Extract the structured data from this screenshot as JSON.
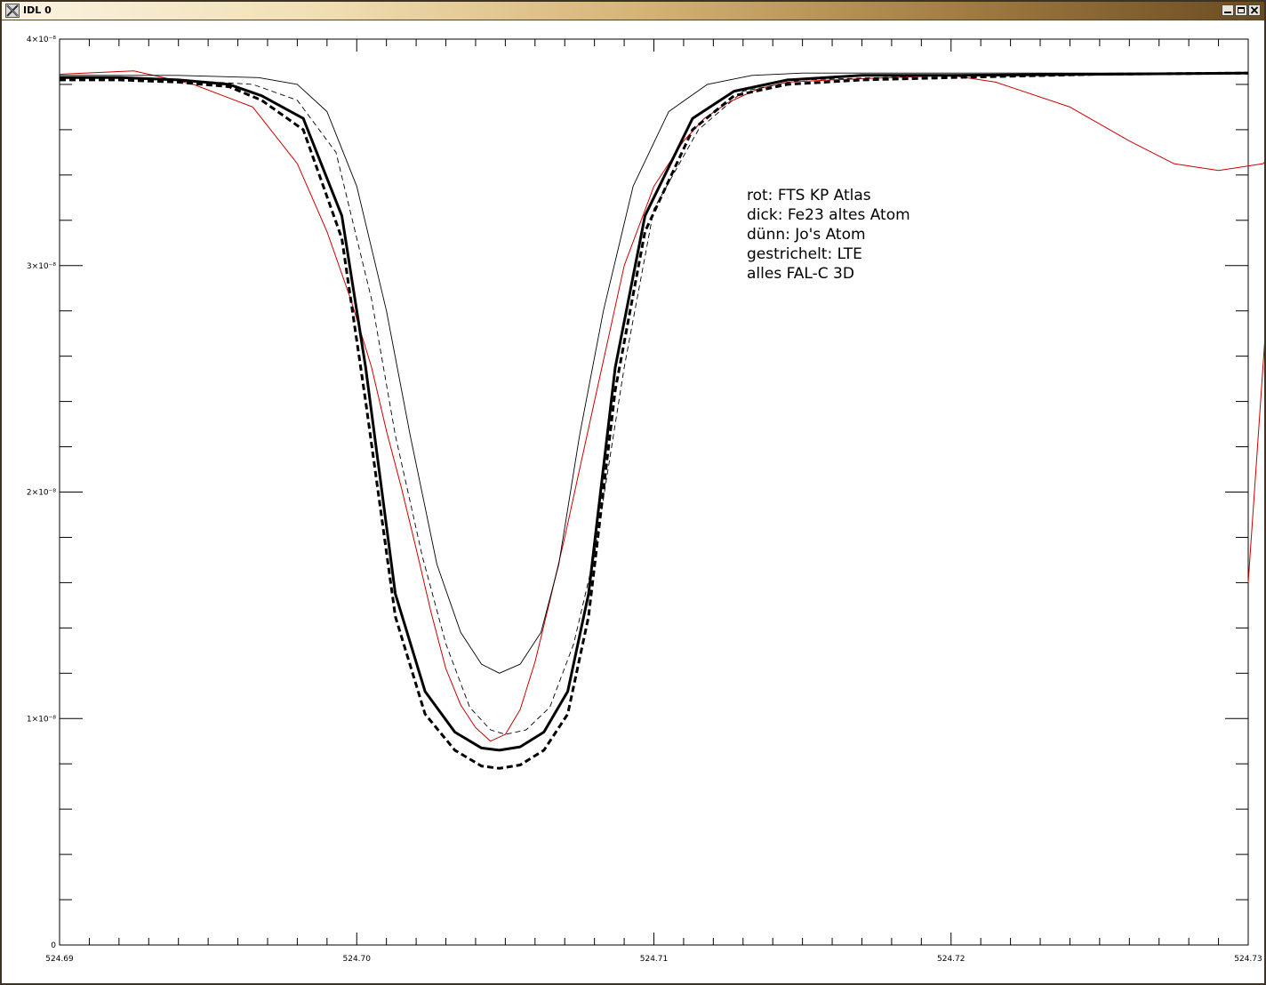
{
  "window": {
    "title": "IDL 0",
    "icon": "x-logo-icon",
    "buttons": [
      {
        "name": "minimize-button",
        "icon": "minimize-icon"
      },
      {
        "name": "maximize-button",
        "icon": "maximize-icon"
      },
      {
        "name": "close-button",
        "icon": "close-icon"
      }
    ]
  },
  "chart_data": {
    "type": "line",
    "title": "",
    "xlabel": "",
    "ylabel": "",
    "xlim": [
      524.69,
      524.73
    ],
    "ylim": [
      0,
      4e-08
    ],
    "x_ticks": [
      {
        "value": 524.69,
        "label": "524.69"
      },
      {
        "value": 524.7,
        "label": "524.70"
      },
      {
        "value": 524.71,
        "label": "524.71"
      },
      {
        "value": 524.72,
        "label": "524.72"
      },
      {
        "value": 524.73,
        "label": "524.73"
      }
    ],
    "y_ticks": [
      {
        "value": 0,
        "label": "0"
      },
      {
        "value": 1e-08,
        "label": "1×10⁻⁸"
      },
      {
        "value": 2e-08,
        "label": "2×10⁻⁸"
      },
      {
        "value": 3e-08,
        "label": "3×10⁻⁸"
      },
      {
        "value": 4e-08,
        "label": "4×10⁻⁸"
      }
    ],
    "legend_text": [
      "rot: FTS KP Atlas",
      "dick: Fe23 altes Atom",
      "dünn: Jo's Atom",
      "gestrichelt: LTE",
      "alles FAL-C 3D"
    ],
    "grid": false,
    "colors": {
      "red": "#cc0000",
      "black": "#000000"
    },
    "series": [
      {
        "style": "red-thin",
        "x": [
          524.69,
          524.6925,
          524.6945,
          524.6965,
          524.698,
          524.699,
          524.6998,
          524.7005,
          524.701,
          524.7015,
          524.702,
          524.7025,
          524.703,
          524.7035,
          524.704,
          524.7045,
          524.705,
          524.7055,
          524.706,
          524.7065,
          524.707,
          524.7075,
          524.708,
          524.7085,
          524.709,
          524.71,
          524.711,
          524.7117,
          524.7125,
          524.7135,
          524.7145,
          524.716,
          524.718,
          524.72,
          524.7215,
          524.724,
          524.726,
          524.7275,
          524.729,
          524.7305,
          524.731,
          524.73
        ],
        "y": [
          3.845e-08,
          3.86e-08,
          3.8e-08,
          3.7e-08,
          3.45e-08,
          3.15e-08,
          2.85e-08,
          2.55e-08,
          2.27e-08,
          2.02e-08,
          1.75e-08,
          1.47e-08,
          1.22e-08,
          1.06e-08,
          9.6e-09,
          9e-09,
          9.3e-09,
          1.04e-08,
          1.25e-08,
          1.52e-08,
          1.8e-08,
          2.1e-08,
          2.4e-08,
          2.7e-08,
          3e-08,
          3.35e-08,
          3.55e-08,
          3.65e-08,
          3.72e-08,
          3.78e-08,
          3.81e-08,
          3.82e-08,
          3.83e-08,
          3.84e-08,
          3.81e-08,
          3.7e-08,
          3.55e-08,
          3.45e-08,
          3.42e-08,
          3.45e-08,
          3.52e-08,
          1.6e-08
        ]
      },
      {
        "style": "black-thick",
        "x": [
          524.69,
          524.692,
          524.694,
          524.6957,
          524.6968,
          524.6982,
          524.6995,
          524.7003,
          524.7013,
          524.7023,
          524.7033,
          524.7042,
          524.7048,
          524.7055,
          524.7063,
          524.7071,
          524.7078,
          524.7087,
          524.7097,
          524.7113,
          524.7127,
          524.7145,
          524.717,
          524.72,
          524.725,
          524.73
        ],
        "y": [
          3.83e-08,
          3.83e-08,
          3.82e-08,
          3.8e-08,
          3.75e-08,
          3.65e-08,
          3.22e-08,
          2.55e-08,
          1.55e-08,
          1.12e-08,
          9.4e-09,
          8.7e-09,
          8.6e-09,
          8.75e-09,
          9.4e-09,
          1.12e-08,
          1.55e-08,
          2.55e-08,
          3.22e-08,
          3.65e-08,
          3.77e-08,
          3.82e-08,
          3.84e-08,
          3.84e-08,
          3.845e-08,
          3.85e-08
        ]
      },
      {
        "style": "black-thin",
        "x": [
          524.69,
          524.692,
          524.694,
          524.6967,
          524.698,
          524.699,
          524.7,
          524.701,
          524.7018,
          524.7027,
          524.7035,
          524.7042,
          524.7048,
          524.7055,
          524.7062,
          524.7068,
          524.7075,
          524.7083,
          524.7093,
          524.7105,
          524.7118,
          524.7133,
          524.715,
          524.72,
          524.73
        ],
        "y": [
          3.84e-08,
          3.84e-08,
          3.84e-08,
          3.83e-08,
          3.8e-08,
          3.68e-08,
          3.35e-08,
          2.8e-08,
          2.25e-08,
          1.68e-08,
          1.38e-08,
          1.24e-08,
          1.2e-08,
          1.24e-08,
          1.38e-08,
          1.68e-08,
          2.25e-08,
          2.8e-08,
          3.35e-08,
          3.68e-08,
          3.8e-08,
          3.84e-08,
          3.85e-08,
          3.85e-08,
          3.85e-08
        ]
      },
      {
        "style": "black-thin-dashed",
        "x": [
          524.69,
          524.692,
          524.694,
          524.6965,
          524.698,
          524.6993,
          524.7005,
          524.7013,
          524.7022,
          524.703,
          524.7038,
          524.7045,
          524.705,
          524.7057,
          524.7065,
          524.7073,
          524.708,
          524.709,
          524.71,
          524.7115,
          524.713,
          524.715,
          524.72,
          524.73
        ],
        "y": [
          3.83e-08,
          3.83e-08,
          3.82e-08,
          3.8e-08,
          3.73e-08,
          3.5e-08,
          2.85e-08,
          2.25e-08,
          1.72e-08,
          1.33e-08,
          1.05e-08,
          9.5e-09,
          9.3e-09,
          9.5e-09,
          1.05e-08,
          1.33e-08,
          1.72e-08,
          2.55e-08,
          3.25e-08,
          3.6e-08,
          3.77e-08,
          3.82e-08,
          3.84e-08,
          3.85e-08
        ]
      },
      {
        "style": "black-thick-dashed",
        "x": [
          524.69,
          524.692,
          524.694,
          524.6957,
          524.6968,
          524.6982,
          524.6995,
          524.7003,
          524.7013,
          524.7023,
          524.7033,
          524.7042,
          524.7048,
          524.7055,
          524.7063,
          524.7071,
          524.7078,
          524.7087,
          524.7097,
          524.7113,
          524.7127,
          524.7145,
          524.717,
          524.72,
          524.725,
          524.73
        ],
        "y": [
          3.82e-08,
          3.82e-08,
          3.81e-08,
          3.79e-08,
          3.73e-08,
          3.6e-08,
          3.12e-08,
          2.4e-08,
          1.45e-08,
          1.02e-08,
          8.6e-09,
          7.9e-09,
          7.8e-09,
          7.95e-09,
          8.6e-09,
          1.02e-08,
          1.45e-08,
          2.45e-08,
          3.15e-08,
          3.6e-08,
          3.75e-08,
          3.8e-08,
          3.82e-08,
          3.83e-08,
          3.845e-08,
          3.85e-08
        ]
      }
    ]
  }
}
